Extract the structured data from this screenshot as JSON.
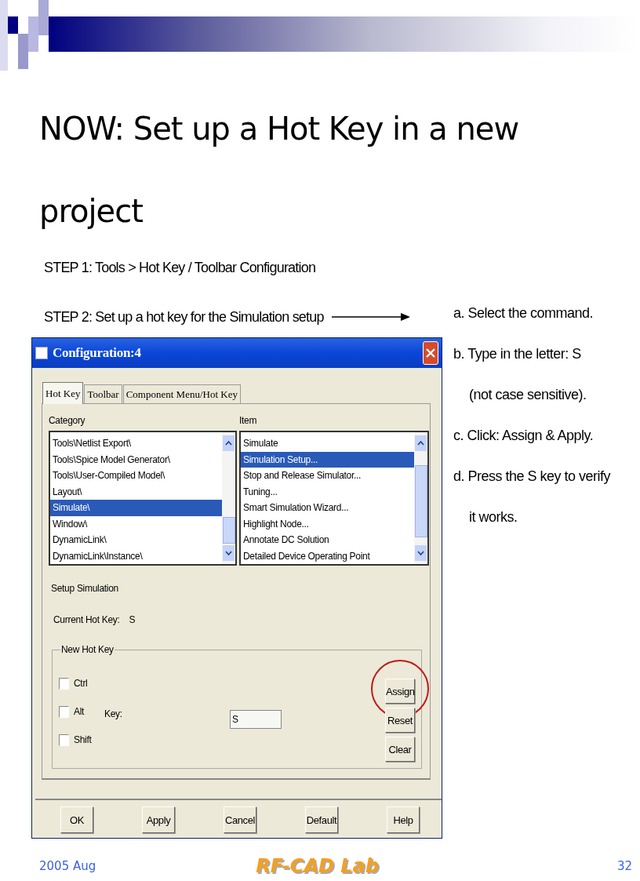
{
  "slide": {
    "title": "NOW: Set up a Hot Key in a new project",
    "steps": [
      "STEP 1: Tools > Hot Key / Toolbar Configuration",
      "STEP 2: Set up a hot key for the Simulation setup"
    ],
    "notes": [
      {
        "kind": "item",
        "text": "a. Select the command."
      },
      {
        "kind": "item",
        "text": "b. Type in the letter: S"
      },
      {
        "kind": "continuation",
        "text": "(not case sensitive)."
      },
      {
        "kind": "item",
        "text": "c. Click: Assign & Apply."
      },
      {
        "kind": "item",
        "text": "d. Press the S key to verify"
      },
      {
        "kind": "continuation",
        "text": "it works."
      }
    ]
  },
  "dialog": {
    "title": "Configuration:4",
    "tabs": [
      {
        "label": "Hot Key",
        "selected": true
      },
      {
        "label": "Toolbar",
        "selected": false
      },
      {
        "label": "Component Menu/Hot Key",
        "selected": false
      }
    ],
    "category": {
      "label": "Category",
      "items": [
        {
          "label": "Tools\\Netlist Export\\",
          "selected": false
        },
        {
          "label": "Tools\\Spice Model Generator\\",
          "selected": false
        },
        {
          "label": "Tools\\User-Compiled Model\\",
          "selected": false
        },
        {
          "label": "Layout\\",
          "selected": false
        },
        {
          "label": "Simulate\\",
          "selected": true
        },
        {
          "label": "Window\\",
          "selected": false
        },
        {
          "label": "DynamicLink\\",
          "selected": false
        },
        {
          "label": "DynamicLink\\Instance\\",
          "selected": false
        }
      ]
    },
    "item": {
      "label": "Item",
      "items": [
        {
          "label": "Simulate",
          "selected": false
        },
        {
          "label": "Simulation Setup...",
          "selected": true
        },
        {
          "label": "Stop and Release Simulator...",
          "selected": false
        },
        {
          "label": "Tuning...",
          "selected": false
        },
        {
          "label": "Smart Simulation Wizard...",
          "selected": false
        },
        {
          "label": "Highlight Node...",
          "selected": false
        },
        {
          "label": "Annotate DC Solution",
          "selected": false
        },
        {
          "label": "Detailed Device Operating Point",
          "selected": false
        }
      ]
    },
    "description": "Setup Simulation",
    "current_hot_key_label": "Current Hot Key:",
    "current_hot_key": "S",
    "new_hot_key": {
      "title": "New Hot Key",
      "modifiers": [
        {
          "label": "Ctrl",
          "checked": false
        },
        {
          "label": "Alt",
          "checked": false
        },
        {
          "label": "Shift",
          "checked": false
        }
      ],
      "key_label": "Key:",
      "key_value": "S",
      "buttons": [
        {
          "label": "Assign",
          "circled": true
        },
        {
          "label": "Reset",
          "circled": false
        },
        {
          "label": "Clear",
          "circled": false
        }
      ]
    },
    "buttons": [
      "OK",
      "Apply",
      "Cancel",
      "Default",
      "Help"
    ]
  },
  "footer": {
    "date": "2005 Aug",
    "logo": "RF-CAD Lab",
    "page": "32"
  }
}
